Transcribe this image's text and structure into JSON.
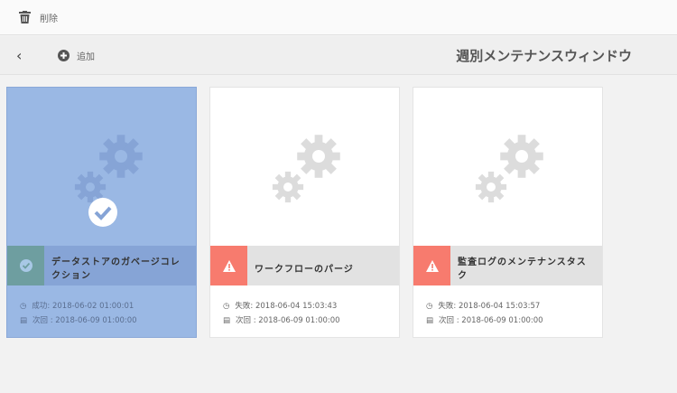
{
  "toolbar": {
    "delete_label": "削除"
  },
  "nav": {
    "add_label": "追加",
    "title": "週別メンテナンスウィンドウ"
  },
  "cards": [
    {
      "name": "データストアのガベージコレクション",
      "status": "success",
      "last": "成功: 2018-06-02 01:00:01",
      "next": "次回 : 2018-06-09 01:00:00",
      "selected": true
    },
    {
      "name": "ワークフローのパージ",
      "status": "failed",
      "last": "失敗: 2018-06-04 15:03:43",
      "next": "次回 : 2018-06-09 01:00:00"
    },
    {
      "name": "監査ログのメンテナンスタスク",
      "status": "failed",
      "last": "失敗: 2018-06-04 15:03:57",
      "next": "次回 : 2018-06-09 01:00:00"
    }
  ],
  "colors": {
    "selected": "#9ab8e4",
    "error": "#f77b6e",
    "success": "#6e9ea0"
  }
}
